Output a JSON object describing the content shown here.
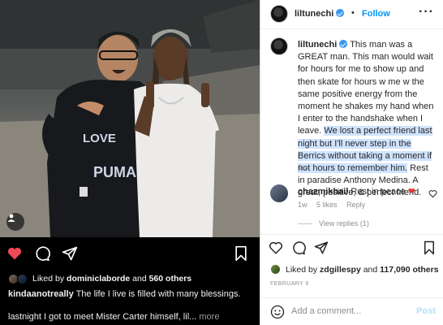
{
  "post": {
    "username": "liltunechi",
    "follow_label": "Follow",
    "dot": "•",
    "more_icon_label": "···"
  },
  "caption": {
    "username": "liltunechi",
    "text_before": "This man was a GREAT man. This man would wait for hours for me to show up and then skate for hours w me w the same positive energy from the moment he shakes my hand when I enter to the handshake when I leave. ",
    "text_highlighted": "We lost a perfect friend last night but I'll never step in the Berrics without taking a moment if not hours to remember him.",
    "text_after": " Rest in paradise Anthony Medina. A great, positive, & perfect friend.",
    "age": "1w"
  },
  "comment": {
    "username": "chazmikhail",
    "text": "Rest in peace",
    "emoji": "❤",
    "age": "1w",
    "likes": "5 likes",
    "reply_label": "Reply",
    "view_replies": "View replies (1)"
  },
  "right_actions": {
    "liked_by_prefix": "Liked by",
    "liked_by_user": "zdgillespy",
    "liked_by_and": "and",
    "liked_by_count": "117,090 others",
    "date": "FEBRUARY 9"
  },
  "add_comment": {
    "placeholder": "Add a comment...",
    "post_label": "Post"
  },
  "dark_feed": {
    "liked_by_prefix": "Liked by",
    "liked_by_user": "dominiclaborde",
    "liked_by_and": "and",
    "liked_by_count": "560 others",
    "cap1_user": "kindaanotreally",
    "cap1_text": "The life I live is filled with many blessings.",
    "cap2_text": "lastnight I got to meet Mister Carter himself, lil...",
    "cap2_more": "more"
  },
  "photo": {
    "hoodie_text_line1": "LOVE",
    "hoodie_text_line2": "PUMA"
  },
  "colors": {
    "accent": "#0095f6",
    "verified": "#3897f0",
    "heart": "#ed4956",
    "highlight": "#cfe3ff"
  },
  "icons": [
    "user-tag-icon",
    "heart-icon",
    "comment-icon",
    "share-icon",
    "bookmark-icon",
    "more-icon",
    "emoji-icon",
    "verified-icon"
  ]
}
